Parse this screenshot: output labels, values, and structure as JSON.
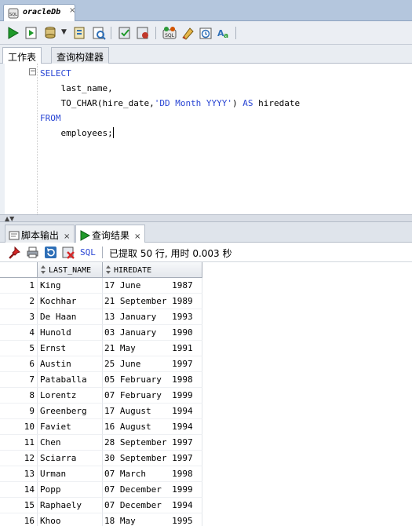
{
  "document_tab": {
    "title": "oracleDb",
    "close": "×"
  },
  "toolbar": {
    "icons": [
      "run-statement-icon",
      "run-script-icon",
      "commit-icon",
      "rollback-icon",
      "explain-plan-icon",
      "autotrace-icon",
      "sql-tuning-icon",
      "clear-icon",
      "history-icon",
      "format-icon"
    ]
  },
  "worksheet_tabs": [
    {
      "label": "工作表"
    },
    {
      "label": "查询构建器"
    }
  ],
  "editor": {
    "fold": "−",
    "lines": [
      {
        "kw": "SELECT",
        "text": ""
      },
      {
        "kw": "",
        "text": "    last_name,"
      },
      {
        "kw": "",
        "text": "    TO_CHAR(hire_date,",
        "str": "'DD Month YYYY'",
        "tail": ")",
        "kw2": " AS",
        "tail2": " hiredate"
      },
      {
        "kw": "FROM",
        "text": ""
      },
      {
        "kw": "",
        "text": "    employees;"
      }
    ]
  },
  "result_tabs": [
    {
      "label": "脚本输出",
      "close": "×"
    },
    {
      "label": "查询结果",
      "close": "×"
    }
  ],
  "result_toolbar": {
    "sql_label": "SQL",
    "status": "已提取 50 行, 用时 0.003 秒"
  },
  "grid": {
    "columns": [
      "LAST_NAME",
      "HIREDATE"
    ],
    "rows": [
      {
        "n": "1",
        "last_name": "King",
        "hiredate": "17 June      1987"
      },
      {
        "n": "2",
        "last_name": "Kochhar",
        "hiredate": "21 September 1989"
      },
      {
        "n": "3",
        "last_name": "De Haan",
        "hiredate": "13 January   1993"
      },
      {
        "n": "4",
        "last_name": "Hunold",
        "hiredate": "03 January   1990"
      },
      {
        "n": "5",
        "last_name": "Ernst",
        "hiredate": "21 May       1991"
      },
      {
        "n": "6",
        "last_name": "Austin",
        "hiredate": "25 June      1997"
      },
      {
        "n": "7",
        "last_name": "Pataballa",
        "hiredate": "05 February  1998"
      },
      {
        "n": "8",
        "last_name": "Lorentz",
        "hiredate": "07 February  1999"
      },
      {
        "n": "9",
        "last_name": "Greenberg",
        "hiredate": "17 August    1994"
      },
      {
        "n": "10",
        "last_name": "Faviet",
        "hiredate": "16 August    1994"
      },
      {
        "n": "11",
        "last_name": "Chen",
        "hiredate": "28 September 1997"
      },
      {
        "n": "12",
        "last_name": "Sciarra",
        "hiredate": "30 September 1997"
      },
      {
        "n": "13",
        "last_name": "Urman",
        "hiredate": "07 March     1998"
      },
      {
        "n": "14",
        "last_name": "Popp",
        "hiredate": "07 December  1999"
      },
      {
        "n": "15",
        "last_name": "Raphaely",
        "hiredate": "07 December  1994"
      },
      {
        "n": "16",
        "last_name": "Khoo",
        "hiredate": "18 May       1995"
      }
    ]
  },
  "colors": {
    "keyword": "#2a46d4",
    "tab_strip": "#b4c6dd",
    "run_green": "#1f9a2a"
  }
}
